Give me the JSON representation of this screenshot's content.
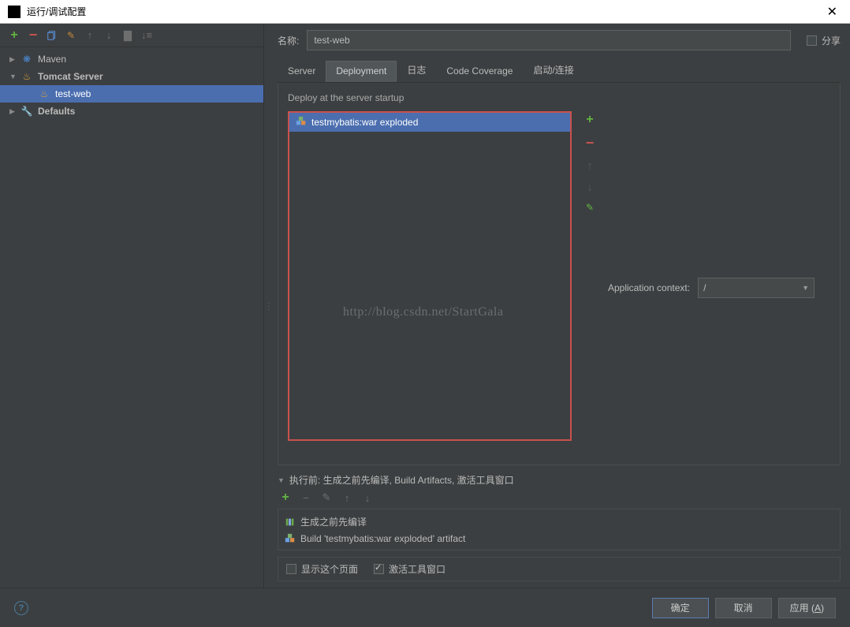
{
  "window": {
    "title": "运行/调试配置"
  },
  "tree": {
    "maven": "Maven",
    "tomcat": "Tomcat Server",
    "testweb": "test-web",
    "defaults": "Defaults"
  },
  "form": {
    "name_label": "名称:",
    "name_value": "test-web",
    "share_label": "分享"
  },
  "tabs": {
    "server": "Server",
    "deployment": "Deployment",
    "logs": "日志",
    "coverage": "Code Coverage",
    "startup": "启动/连接"
  },
  "deploy": {
    "header": "Deploy at the server startup",
    "artifact": "testmybatis:war exploded",
    "context_label": "Application context:",
    "context_value": "/"
  },
  "watermark": "http://blog.csdn.net/StartGala",
  "before_launch": {
    "header": "执行前: 生成之前先编译, Build Artifacts, 激活工具窗口",
    "task_build": "生成之前先编译",
    "task_artifact": "Build 'testmybatis:war exploded' artifact",
    "show_page": "显示这个页面",
    "activate_tool": "激活工具窗口"
  },
  "buttons": {
    "ok": "确定",
    "cancel": "取消",
    "apply_prefix": "应用 (",
    "apply_key": "A",
    "apply_suffix": ")"
  }
}
